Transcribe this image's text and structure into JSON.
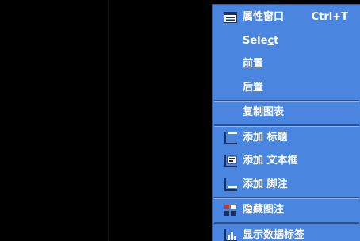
{
  "context_menu": {
    "items": [
      {
        "label": "属性窗口",
        "shortcut": "Ctrl+T",
        "icon": "properties-window-icon"
      },
      {
        "label_before": "Sele",
        "label_access": "c",
        "label_after": "t"
      },
      {
        "label": "前置"
      },
      {
        "label": "后置"
      },
      {
        "label": "复制图表"
      },
      {
        "label": "添加 标题",
        "icon": "add-title-icon"
      },
      {
        "label": "添加 文本框",
        "icon": "add-textbox-icon"
      },
      {
        "label": "添加 脚注",
        "icon": "add-footnote-icon"
      },
      {
        "label": "隐藏图注",
        "icon": "hide-legend-icon"
      },
      {
        "label": "显示数据标签",
        "icon": "show-data-labels-icon"
      }
    ]
  },
  "colors": {
    "menu_background": "#4a86e0",
    "menu_text": "#ffffff",
    "backdrop": "#000000"
  }
}
